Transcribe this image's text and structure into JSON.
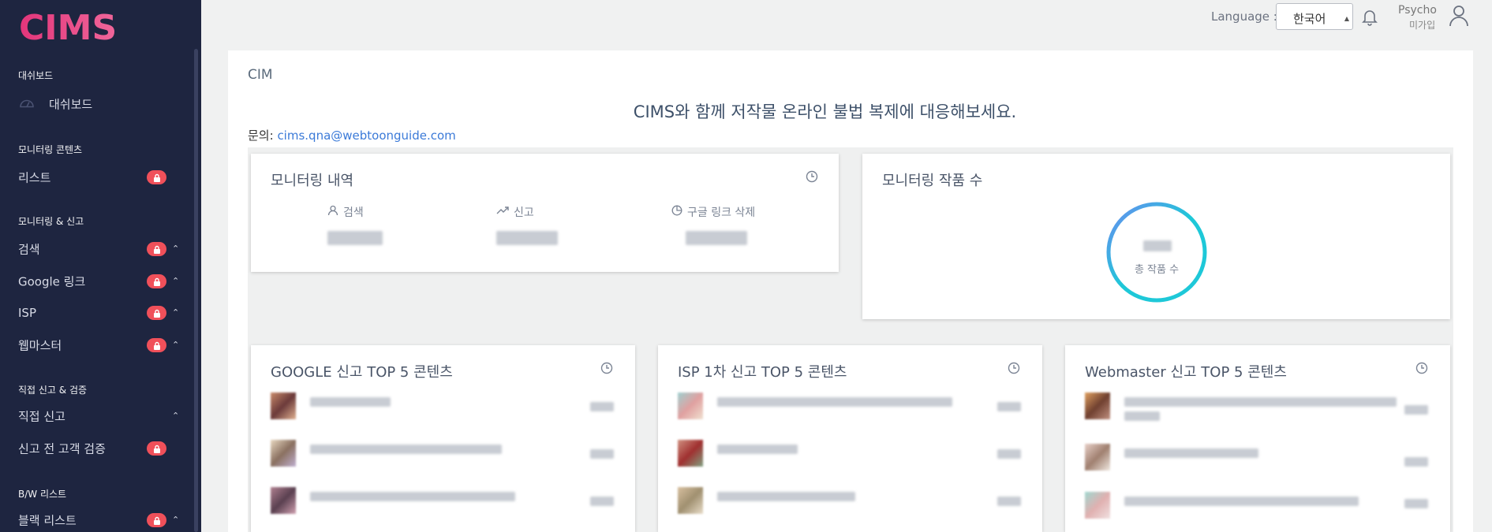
{
  "app": {
    "logo_text": "CIMS"
  },
  "header": {
    "language_label": "Language :",
    "language_value": "한국어",
    "user_name": "Psycho",
    "user_sub": "미가입"
  },
  "sidebar": {
    "sections": [
      {
        "title": "대쉬보드",
        "items": [
          {
            "label": "대쉬보드"
          }
        ]
      },
      {
        "title": "모니터링 콘텐츠",
        "items": [
          {
            "label": "리스트"
          }
        ]
      },
      {
        "title": "모니터링 & 신고",
        "items": [
          {
            "label": "검색"
          },
          {
            "label": "Google 링크"
          },
          {
            "label": "ISP"
          },
          {
            "label": "웹마스터"
          }
        ]
      },
      {
        "title": "직접 신고 & 검증",
        "items": [
          {
            "label": "직접 신고"
          },
          {
            "label": "신고 전 고객 검증"
          }
        ]
      },
      {
        "title": "B/W 리스트",
        "items": [
          {
            "label": "블랙 리스트"
          }
        ]
      }
    ]
  },
  "main": {
    "breadcrumb": "CIM",
    "headline": "CIMS와 함께 저작물 온라인 불법 복제에 대응해보세요.",
    "contact_label": "문의:",
    "contact_email": "cims.qna@webtoonguide.com",
    "monitoring_history": {
      "title": "모니터링 내역",
      "stats": [
        {
          "label": "검색"
        },
        {
          "label": "신고"
        },
        {
          "label": "구글 링크 삭제"
        }
      ]
    },
    "monitoring_works": {
      "title": "모니터링 작품 수",
      "ring_caption": "총 작품 수"
    },
    "top5": [
      {
        "title": "GOOGLE 신고 TOP 5 콘텐츠"
      },
      {
        "title": "ISP 1차 신고 TOP 5 콘텐츠"
      },
      {
        "title": "Webmaster 신고 TOP 5 콘텐츠"
      }
    ]
  },
  "colors": {
    "sidebar_bg": "#1e2540",
    "lock_badge": "#f0505a",
    "ring": "#1ec8d8",
    "link": "#3b7ad8"
  }
}
